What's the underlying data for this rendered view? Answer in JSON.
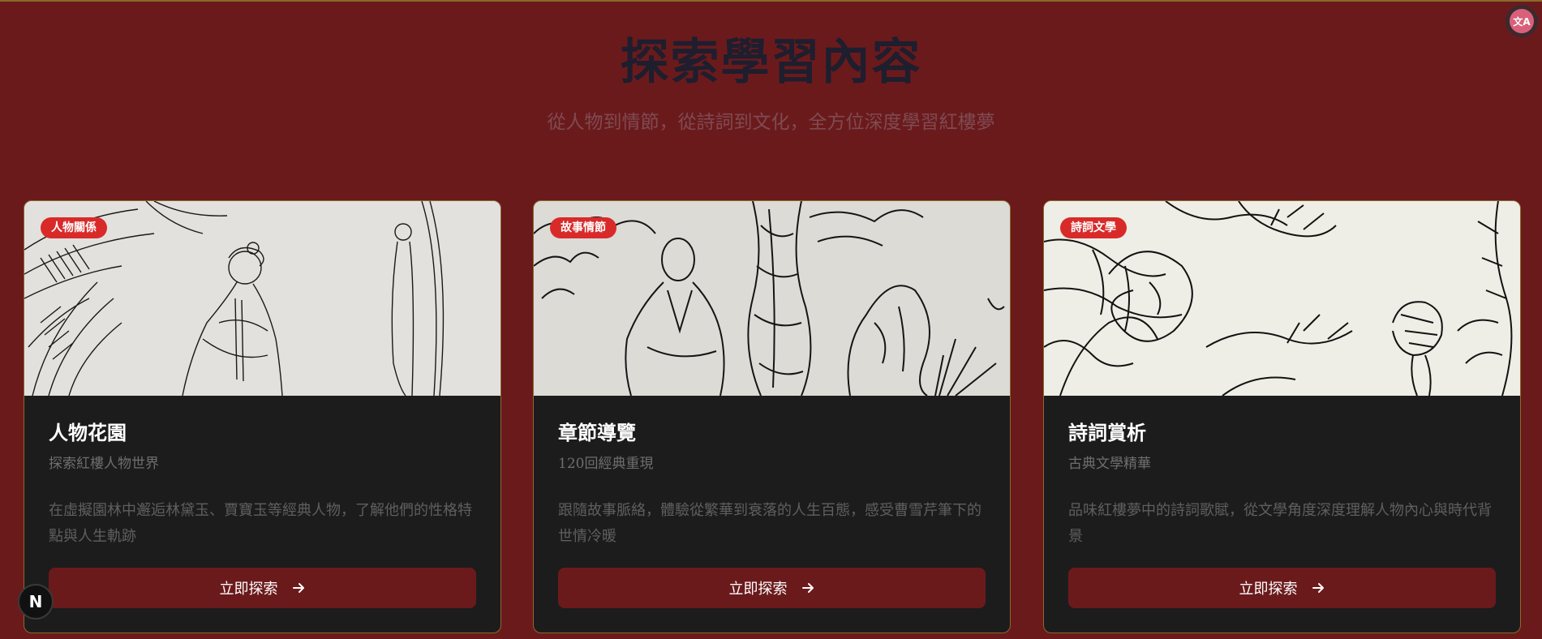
{
  "header": {
    "title": "探索學習內容",
    "subtitle": "從人物到情節，從詩詞到文化，全方位深度學習紅樓夢"
  },
  "cards": [
    {
      "badge": "人物關係",
      "title": "人物花園",
      "subtitle": "探索紅樓人物世界",
      "description": "在虛擬園林中邂逅林黛玉、賈寶玉等經典人物，了解他們的性格特點與人生軌跡",
      "button_label": "立即探索",
      "image": "line-drawing-lady-with-banana-leaves"
    },
    {
      "badge": "故事情節",
      "title": "章節導覽",
      "subtitle": "120回經典重現",
      "description": "跟隨故事脈絡，體驗從繁華到衰落的人生百態，感受曹雪芹筆下的世情冷暖",
      "button_label": "立即探索",
      "image": "line-drawing-scholar-with-tree-and-rock"
    },
    {
      "badge": "詩詞文學",
      "title": "詩詞賞析",
      "subtitle": "古典文學精華",
      "description": "品味紅樓夢中的詩詞歌賦，從文學角度深度理解人物內心與時代背景",
      "button_label": "立即探索",
      "image": "line-drawing-branches-and-figure"
    }
  ],
  "floating": {
    "next_badge_letter": "N",
    "translate_label": "文A"
  },
  "colors": {
    "background": "#6b1a1c",
    "card": "#1c1c1c",
    "badge": "#d92a2a",
    "border": "#8a6a2a"
  }
}
